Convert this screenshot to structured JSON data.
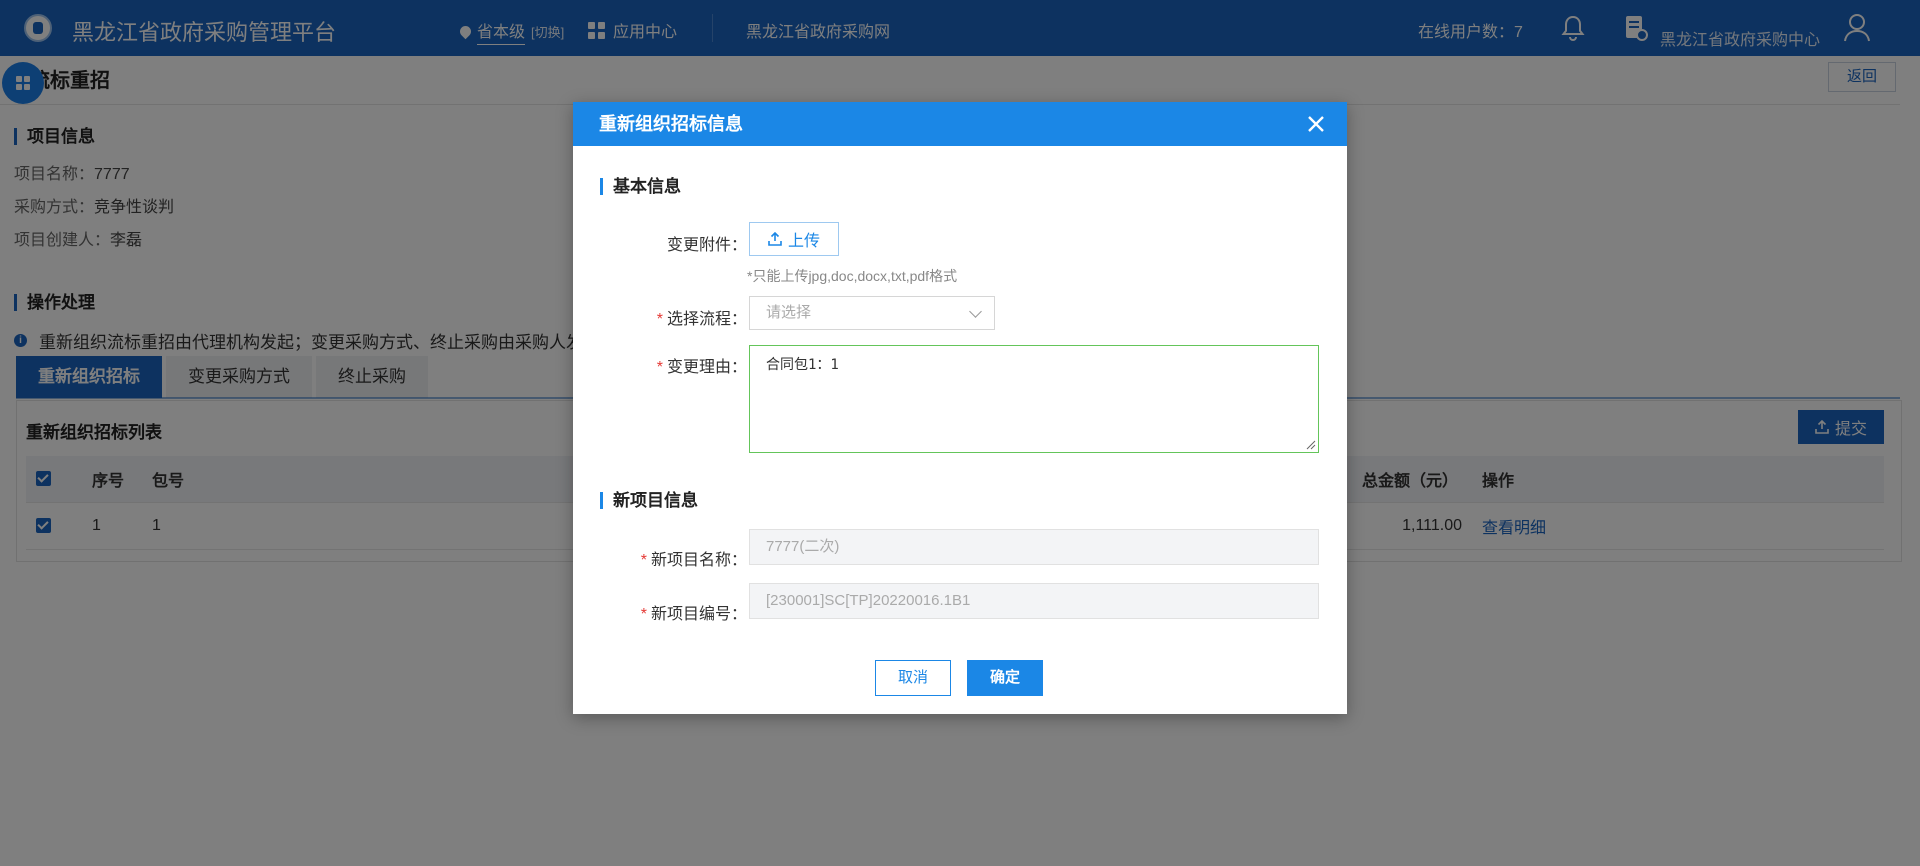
{
  "header": {
    "app_title": "黑龙江省政府采购管理平台",
    "region": "省本级",
    "switch_label": "[切换]",
    "app_center": "应用中心",
    "site_link": "黑龙江省政府采购网",
    "online_users": "在线用户数：7",
    "org_name": "黑龙江省政府采购中心"
  },
  "page": {
    "title": "流标重招",
    "back_label": "返回"
  },
  "project_info": {
    "heading": "项目信息",
    "name_label": "项目名称：",
    "name_value": "7777",
    "method_label": "采购方式：",
    "method_value": "竞争性谈判",
    "creator_label": "项目创建人：",
    "creator_value": "李磊"
  },
  "operation": {
    "heading": "操作处理",
    "notice": "重新组织流标重招由代理机构发起；变更采购方式、终止采购由采购人发起",
    "tabs": [
      "重新组织招标",
      "变更采购方式",
      "终止采购"
    ],
    "active_tab": 0
  },
  "list": {
    "title": "重新组织招标列表",
    "submit_label": "提交",
    "columns": [
      "序号",
      "包号",
      "总金额（元）",
      "操作"
    ],
    "rows": [
      {
        "seq": "1",
        "package": "1",
        "amount": "1,111.00",
        "action": "查看明细"
      }
    ]
  },
  "modal": {
    "title": "重新组织招标信息",
    "basic_heading": "基本信息",
    "attachment_label": "变更附件：",
    "upload_label": "上传",
    "upload_hint": "*只能上传jpg,doc,docx,txt,pdf格式",
    "flow_label": "选择流程：",
    "flow_placeholder": "请选择",
    "reason_label": "变更理由：",
    "reason_value": "合同包1：1",
    "new_heading": "新项目信息",
    "new_name_label": "新项目名称：",
    "new_name_value": "7777(二次)",
    "new_code_label": "新项目编号：",
    "new_code_value": "[230001]SC[TP]20220016.1B1",
    "cancel_label": "取消",
    "ok_label": "确定"
  },
  "colors": {
    "header_blue": "#1a65c0",
    "modal_blue": "#1b87e6",
    "required_red": "#e53935",
    "focus_green": "#64c55a"
  }
}
